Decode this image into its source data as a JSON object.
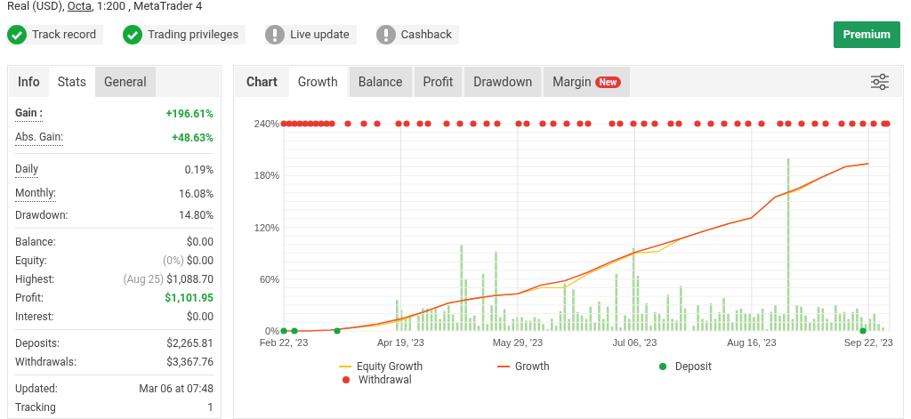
{
  "account_line": {
    "before": "Real (USD), ",
    "link": "Octa",
    "after": ", 1:200 , MetaTrader 4"
  },
  "badges": [
    {
      "label": "Track record",
      "verified": true
    },
    {
      "label": "Trading privileges",
      "verified": true
    },
    {
      "label": "Live update",
      "verified": false
    },
    {
      "label": "Cashback",
      "verified": false
    }
  ],
  "premium_button": "Premium",
  "stats_tabs": [
    {
      "label": "Info",
      "selected": false
    },
    {
      "label": "Stats",
      "selected": true
    },
    {
      "label": "General",
      "selected": false
    }
  ],
  "stats_groups": [
    [
      {
        "label": "Gain :",
        "value": "+196.61%",
        "dotted": true,
        "bold": true,
        "positive": true
      },
      {
        "label": "Abs. Gain:",
        "value": "+48.63%",
        "dotted": true,
        "bold": false,
        "positive": true
      }
    ],
    [
      {
        "label": "Daily",
        "value": "0.19%",
        "dotted": true,
        "bold": false,
        "positive": false
      },
      {
        "label": "Monthly:",
        "value": "16.08%",
        "dotted": true,
        "bold": false,
        "positive": false
      },
      {
        "label": "Drawdown:",
        "value": "14.80%",
        "dotted": false,
        "bold": false,
        "positive": false
      }
    ],
    [
      {
        "label": "Balance:",
        "value": "$0.00",
        "dotted": false,
        "bold": false,
        "positive": false
      },
      {
        "label": "Equity:",
        "note": "(0%)",
        "value": "$0.00",
        "dotted": false,
        "bold": false,
        "positive": false
      },
      {
        "label": "Highest:",
        "note": "(Aug 25)",
        "value": "$1,088.70",
        "dotted": false,
        "bold": false,
        "positive": false
      },
      {
        "label": "Profit:",
        "value": "$1,101.95",
        "dotted": false,
        "bold": false,
        "positive": true
      },
      {
        "label": "Interest:",
        "value": "$0.00",
        "dotted": false,
        "bold": false,
        "positive": false
      }
    ],
    [
      {
        "label": "Deposits:",
        "value": "$2,265.81",
        "dotted": false,
        "bold": false,
        "positive": false
      },
      {
        "label": "Withdrawals:",
        "value": "$3,367.76",
        "dotted": false,
        "bold": false,
        "positive": false
      }
    ],
    [
      {
        "label": "Updated:",
        "value": "Mar 06 at 07:48",
        "dotted": false,
        "bold": false,
        "positive": false
      },
      {
        "label": "Tracking",
        "value": "1",
        "dotted": false,
        "bold": false,
        "positive": false
      }
    ]
  ],
  "chart_panel": {
    "title": "Chart",
    "tabs": [
      {
        "label": "Growth",
        "selected": true
      },
      {
        "label": "Balance",
        "selected": false
      },
      {
        "label": "Profit",
        "selected": false
      },
      {
        "label": "Drawdown",
        "selected": false
      },
      {
        "label": "Margin",
        "selected": false,
        "badge": "New"
      }
    ],
    "chart_data": {
      "type": "line",
      "categories": [
        "Feb 22, '23",
        null,
        null,
        null,
        null,
        "Apr 19, '23",
        null,
        null,
        null,
        null,
        "May 29, '23",
        null,
        null,
        null,
        null,
        "Jul 06, '23",
        null,
        null,
        null,
        null,
        "Aug 16, '23",
        null,
        null,
        null,
        null,
        "Sep 22, '23"
      ],
      "grid": true,
      "ylim": [
        0,
        240
      ],
      "yticks": [
        {
          "value": 0,
          "label": "0%"
        },
        {
          "value": 60,
          "label": "60%"
        },
        {
          "value": 120,
          "label": "120%"
        },
        {
          "value": 180,
          "label": "180%"
        },
        {
          "value": 240,
          "label": "240%"
        }
      ],
      "series": [
        {
          "name": "Equity Growth",
          "color": "#f5c518",
          "values": [
            null,
            null,
            1,
            4,
            6,
            12,
            22,
            32,
            37,
            41,
            43,
            50,
            50,
            66,
            78,
            90,
            92,
            107,
            116,
            124,
            131,
            155,
            163,
            178,
            190,
            193
          ]
        },
        {
          "name": "Growth",
          "color": "#f15a2b",
          "values": [
            0,
            0,
            1,
            4,
            8,
            14,
            22,
            32,
            37,
            41,
            43,
            53,
            58,
            68,
            80,
            91,
            99,
            107,
            116,
            124,
            131,
            155,
            165,
            178,
            190,
            194
          ]
        }
      ]
    },
    "legend_markers": [
      {
        "name": "Deposit",
        "color": "#15a83c"
      },
      {
        "name": "Withdrawal",
        "color": "#e8392f"
      }
    ]
  }
}
